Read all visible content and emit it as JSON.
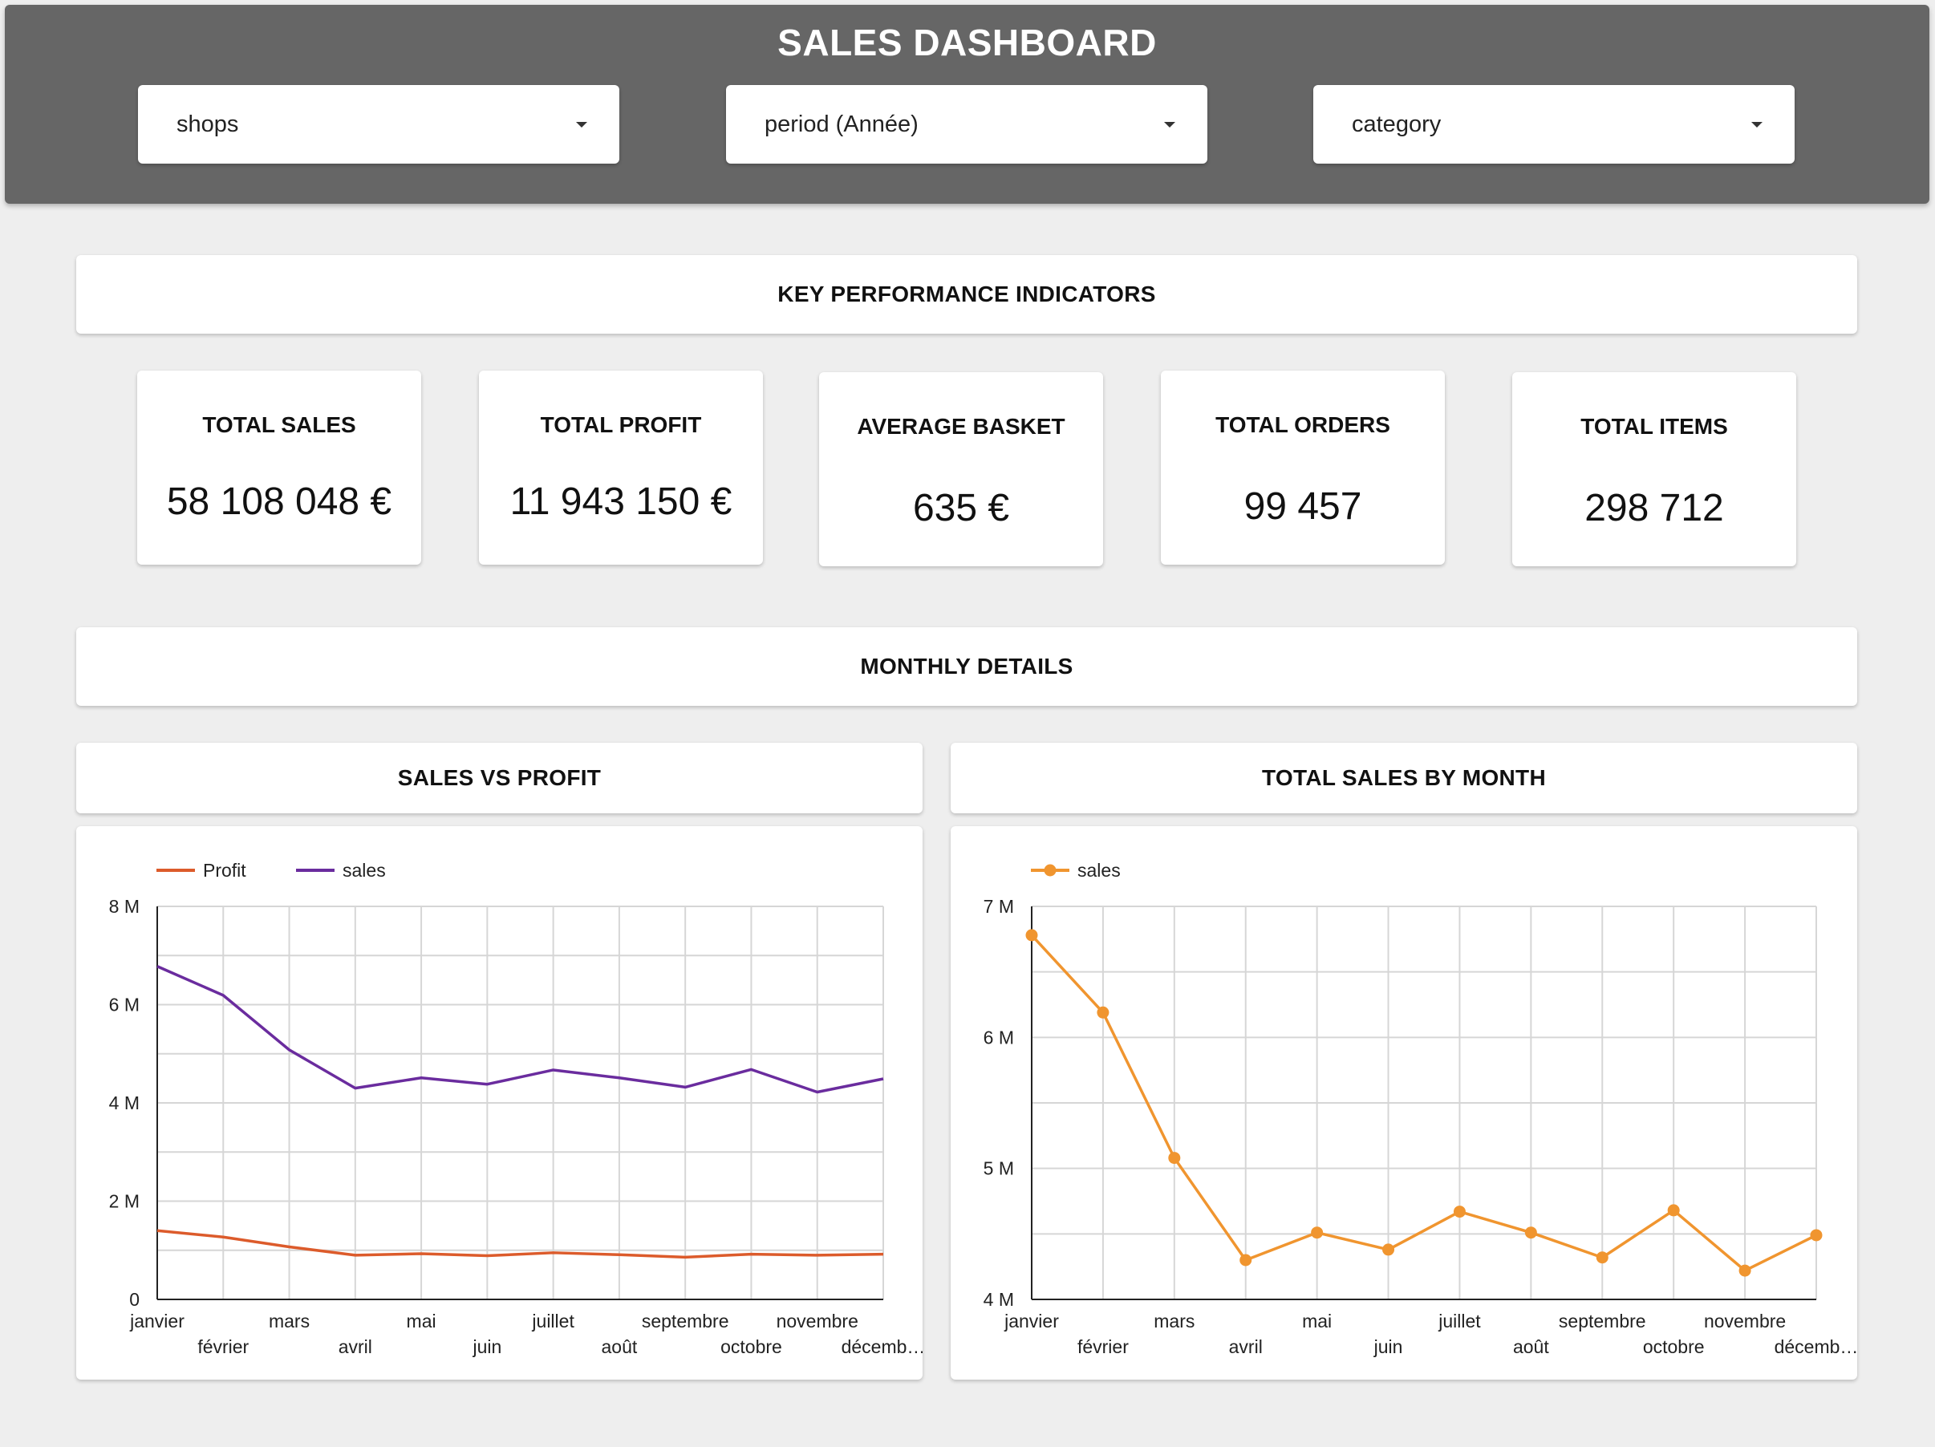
{
  "header": {
    "title": "SALES DASHBOARD",
    "filters": [
      {
        "label": "shops"
      },
      {
        "label": "period (Année)"
      },
      {
        "label": "category"
      }
    ]
  },
  "sections": {
    "kpi": "KEY PERFORMANCE INDICATORS",
    "monthly": "MONTHLY DETAILS"
  },
  "kpis": [
    {
      "label": "TOTAL SALES",
      "value": "58 108 048 €"
    },
    {
      "label": "TOTAL PROFIT",
      "value": "11 943 150 €"
    },
    {
      "label": "AVERAGE BASKET",
      "value": "635 €"
    },
    {
      "label": "TOTAL ORDERS",
      "value": "99 457"
    },
    {
      "label": "TOTAL ITEMS",
      "value": "298 712"
    }
  ],
  "charts_titles": {
    "left": "SALES VS PROFIT",
    "right": "TOTAL SALES BY MONTH"
  },
  "chart_data": [
    {
      "type": "line",
      "categories": [
        "janvier",
        "février",
        "mars",
        "avril",
        "mai",
        "juin",
        "juillet",
        "août",
        "septembre",
        "octobre",
        "novembre",
        "décemb…"
      ],
      "series": [
        {
          "name": "Profit",
          "color": "#dc5b2b",
          "values": [
            1.4,
            1.27,
            1.07,
            0.9,
            0.93,
            0.89,
            0.95,
            0.91,
            0.86,
            0.92,
            0.9,
            0.92
          ]
        },
        {
          "name": "sales",
          "color": "#6a2c9e",
          "values": [
            6.78,
            6.19,
            5.08,
            4.3,
            4.51,
            4.38,
            4.67,
            4.51,
            4.32,
            4.68,
            4.22,
            4.49
          ]
        }
      ],
      "yticks": [
        "0",
        "2 M",
        "4 M",
        "6 M",
        "8 M"
      ],
      "ylim": [
        0,
        8
      ],
      "legend": "top-left",
      "grid": true
    },
    {
      "type": "line",
      "markers": true,
      "categories": [
        "janvier",
        "février",
        "mars",
        "avril",
        "mai",
        "juin",
        "juillet",
        "août",
        "septembre",
        "octobre",
        "novembre",
        "décemb…"
      ],
      "series": [
        {
          "name": "sales",
          "color": "#f0952f",
          "values": [
            6.78,
            6.19,
            5.08,
            4.3,
            4.51,
            4.38,
            4.67,
            4.51,
            4.32,
            4.68,
            4.22,
            4.49
          ]
        }
      ],
      "yticks": [
        "4 M",
        "5 M",
        "6 M",
        "7 M"
      ],
      "ylim": [
        4,
        7
      ],
      "legend": "top-left",
      "grid": true
    }
  ]
}
